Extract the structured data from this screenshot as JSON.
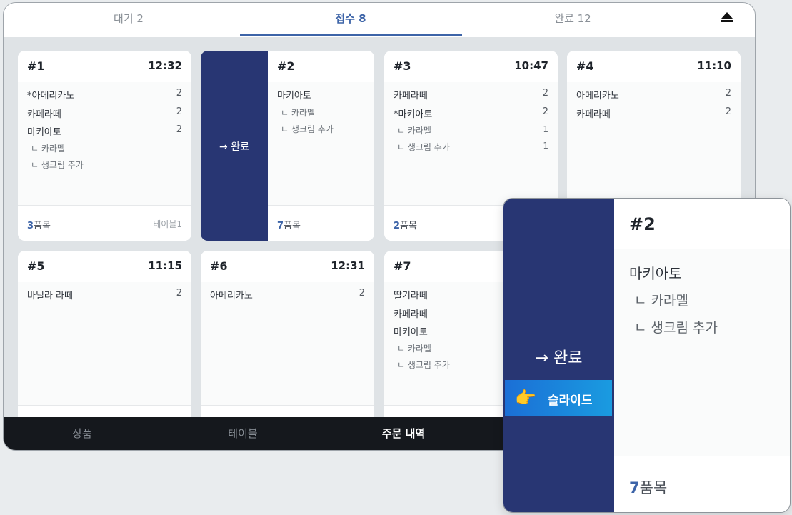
{
  "tabs": [
    {
      "label": "대기 2"
    },
    {
      "label": "접수 8"
    },
    {
      "label": "완료 12"
    }
  ],
  "cards": [
    {
      "num": "#1",
      "time": "12:32",
      "items": [
        {
          "name": "*아메리카노",
          "qty": "2"
        },
        {
          "name": "카페라떼",
          "qty": "2"
        },
        {
          "name": "마키아토",
          "qty": "2"
        }
      ],
      "options": [
        {
          "name": "ㄴ 카라멜",
          "qty": ""
        },
        {
          "name": "ㄴ 생크림 추가",
          "qty": ""
        }
      ],
      "count_num": "3",
      "count_unit": "품목",
      "table": "테이블1"
    },
    {
      "num": "#2",
      "time": "",
      "items": [
        {
          "name": "마키아토",
          "qty": ""
        }
      ],
      "options": [
        {
          "name": "ㄴ 카라멜",
          "qty": ""
        },
        {
          "name": "ㄴ 생크림 추가",
          "qty": ""
        }
      ],
      "count_num": "7",
      "count_unit": "품목",
      "table": "",
      "slide_label": "→ 완료"
    },
    {
      "num": "#3",
      "time": "10:47",
      "items": [
        {
          "name": "카페라떼",
          "qty": "2"
        },
        {
          "name": "*마키아토",
          "qty": "2"
        }
      ],
      "options": [
        {
          "name": "ㄴ 카라멜",
          "qty": "1"
        },
        {
          "name": "ㄴ 생크림 추가",
          "qty": "1"
        }
      ],
      "count_num": "2",
      "count_unit": "품목",
      "table": ""
    },
    {
      "num": "#4",
      "time": "11:10",
      "items": [
        {
          "name": "아메리카노",
          "qty": "2"
        },
        {
          "name": "카페라떼",
          "qty": "2"
        }
      ],
      "options": [],
      "count_num": "",
      "count_unit": "",
      "table": ""
    },
    {
      "num": "#5",
      "time": "11:15",
      "items": [
        {
          "name": "바닐라 라떼",
          "qty": "2"
        }
      ],
      "options": [],
      "count_num": "",
      "count_unit": "",
      "table": ""
    },
    {
      "num": "#6",
      "time": "12:31",
      "items": [
        {
          "name": "아메리카노",
          "qty": "2"
        }
      ],
      "options": [],
      "count_num": "",
      "count_unit": "",
      "table": ""
    },
    {
      "num": "#7",
      "time": "",
      "items": [
        {
          "name": "딸기라떼",
          "qty": ""
        },
        {
          "name": "카페라떼",
          "qty": ""
        },
        {
          "name": "마키아토",
          "qty": ""
        }
      ],
      "options": [
        {
          "name": "ㄴ 카라멜",
          "qty": ""
        },
        {
          "name": "ㄴ 생크림 추가",
          "qty": ""
        }
      ],
      "count_num": "",
      "count_unit": "",
      "table": ""
    }
  ],
  "bottom_nav": [
    {
      "label": "상품"
    },
    {
      "label": "테이블"
    },
    {
      "label": "주문 내역"
    }
  ],
  "zoom": {
    "done_label": "→ 완료",
    "hint_icon": "pointing-hand-icon",
    "hint_label": "슬라이드",
    "num": "#2",
    "item": "마키아토",
    "options": [
      "ㄴ 카라멜",
      "ㄴ 생크림 추가"
    ],
    "count_num": "7",
    "count_unit": "품목"
  },
  "colors": {
    "accent": "#3d64a8",
    "panel": "#283673",
    "nav_bg": "#15181d"
  }
}
